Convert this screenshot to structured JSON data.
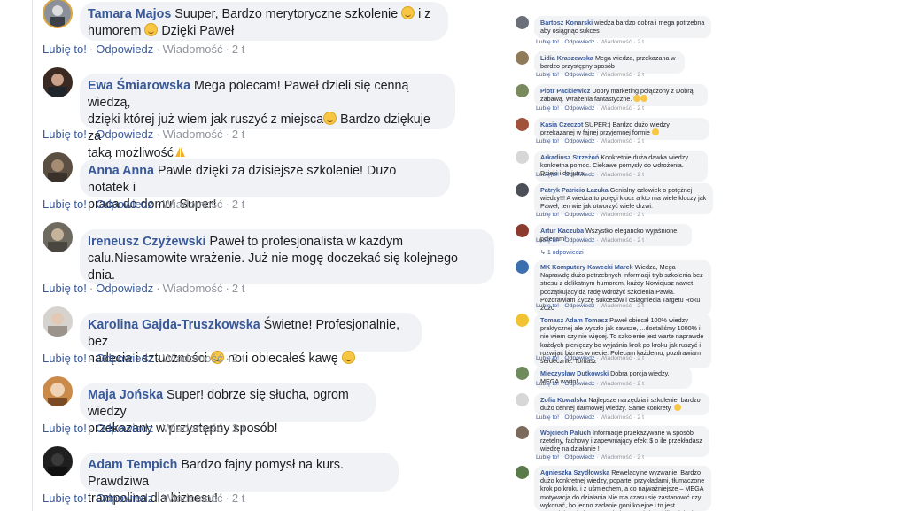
{
  "actions": {
    "like": "Lubię to!",
    "reply": "Odpowiedz",
    "message": "Wiadomość",
    "time": "2 t",
    "dot": "·"
  },
  "left_comments": [
    {
      "name": "Tamara Majos",
      "line1": "Suuper, Bardzo merytoryczne szkolenie",
      "line1b": "i z",
      "line2a": "humorem",
      "line2b": "Dzięki Paweł"
    },
    {
      "name": "Ewa Śmiarowska",
      "line1": "Mega polecam! Paweł dzieli się cenną wiedzą,",
      "line2a": "dzięki której już wiem jak ruszyć z miejsca",
      "line2b": "Bardzo dziękuje za",
      "line3": "taką możliwość"
    },
    {
      "name": "Anna Anna",
      "line1": "Pawle dzięki za dzisiejsze szkolenie! Duzo notatek i",
      "line2": "praca do domu! Super!"
    },
    {
      "name": "Ireneusz Czyżewski",
      "line1": "Paweł to profesjonalista w każdym",
      "line2": "calu.Niesamowite wrażenie. Już nie mogę doczekać się kolejnego",
      "line3": "dnia."
    },
    {
      "name": "Karolina Gajda-Truszkowska",
      "line1": "Świetne! Profesjonalnie, bez",
      "line2a": "nadęcia i sztuczności",
      "line2b": "no i obiecałeś kawę"
    },
    {
      "name": "Maja Jońska",
      "line1": "Super! dobrze się słucha, ogrom wiedzy",
      "line2": "przekazany w przystępny sposób!"
    },
    {
      "name": "Adam Tempich",
      "line1": "Bardzo fajny pomysł na kurs. Prawdziwa",
      "line2": "trampolina dla biznesu!"
    }
  ],
  "right_comments": [
    {
      "name": "Bartosz Konarski",
      "text": "wiedza bardzo dobra i mega potrzebna aby osiągnąc sukces"
    },
    {
      "name": "Lidia Kraszewska",
      "text": "Mega wiedza, przekazana w bardzo przystępny sposób"
    },
    {
      "name": "Piotr Packiewicz",
      "text": "Dobry marketing połączony z Dobrą zabawą. Wrażenia fantastyczne."
    },
    {
      "name": "Kasia Czeczot",
      "text": "SUPER:) Bardzo dużo wiedzy przekazanej w fajnej przyjemnej formie"
    },
    {
      "name": "Arkadiusz Strzeżoń",
      "text": "Konkretnie duża dawka wiedzy konkretna pomoc. Ciekawe pomysły do wdrożenia. Dzięki i do jutra."
    },
    {
      "name": "Patryk Patricio Łazuka",
      "text": "Genialny człowiek o potężnej wiedzy!!! A wiedza to potęgi klucz a kto ma wiele kluczy jak Paweł, ten wie jak otworzyć wiele drzwi."
    },
    {
      "name": "Artur Kaczuba",
      "text": "Wszystko elegancko wyjaśnione, polecam!"
    },
    {
      "name": "MK Komputery Kawecki Marek",
      "text": "Wiedza, Mega Naprawdę dużo potrzebnych informacji tryb szkolenia bez stresu z delikatnym humorem, każdy Nowicjusz nawet początkujący da radę wdrożyć szkolenia Pawła. Pozdrawiam Życzę sukcesów i osiągniecia Targetu Roku 2020"
    },
    {
      "name": "Tomasz Adam Tomasz",
      "text": "Paweł obiecał 100% wiedzy praktycznej ale wyszło jak zawsze, ...dostaliśmy 1000% i nie wiem czy nie więcej. To szkolenie jest warte naprawdę każdych pieniędzy bo wyjaśnia krok po kroku jak ruszyć i rozwijać biznes w necie. Polecam każdemu, pozdrawiam serdecznie. Tomasz"
    },
    {
      "name": "Mieczysław Dutkowski",
      "text": "Dobra porcja wiedzy. MEGA warto!"
    },
    {
      "name": "Zofia Kowalska",
      "text": "Najlepsze narzędzia i szkolenie, bardzo dużo cennej darmowej wiedzy. Same konkrety."
    },
    {
      "name": "Wojciech Paluch",
      "text": "Informacje przekazywane w sposób rzetelny, fachowy i zapewniający efekt $ o ile przekładasz wiedzę na działanie !"
    },
    {
      "name": "Agnieszka Szydłowska",
      "text": "Rewelacyjne wyzwanie. Bardzo dużo konkretnej wiedzy, popartej przykładami, tłumaczone krok po kroku i z uśmiechem, a co najważniejsze – MEGA motywacja do działania Nie ma czasu się zastanowić czy wykonać, bo jedno zadanie goni kolejne i to jest wspaniałe. Nie jestem techniczna, a już po kilku dniach wykonałam więcej niż czasami w miesiąc."
    }
  ],
  "replies_label": "1 odpowiedzi",
  "colors": {
    "name": "#385898",
    "bubble": "#f0f2f5",
    "text": "#1c1e21",
    "meta": "#65676b"
  }
}
